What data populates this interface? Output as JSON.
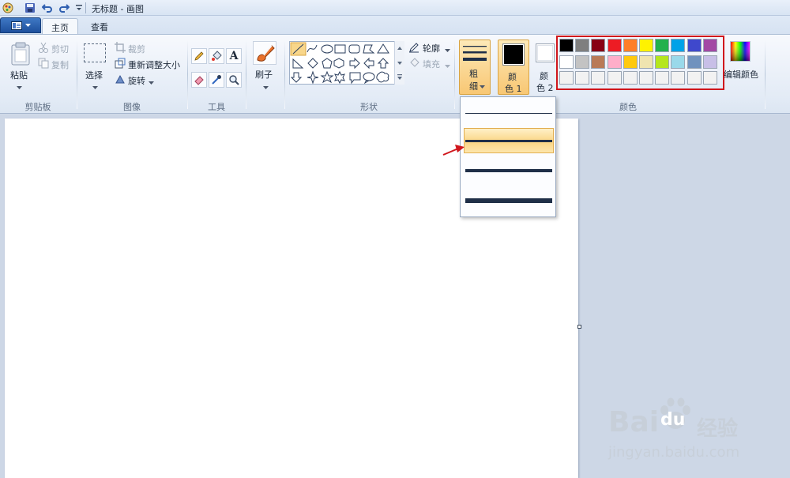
{
  "window": {
    "title": "无标题 - 画图"
  },
  "tabs": {
    "file_icon": "menu-icon",
    "home": "主页",
    "view": "查看"
  },
  "clipboard": {
    "paste": "粘贴",
    "cut": "剪切",
    "copy": "复制",
    "group": "剪贴板"
  },
  "image": {
    "select": "选择",
    "crop": "裁剪",
    "resize": "重新调整大小",
    "rotate": "旋转",
    "group": "图像"
  },
  "tools": {
    "group": "工具"
  },
  "brush": {
    "label": "刷子"
  },
  "shapes": {
    "outline": "轮廓",
    "fill": "填充",
    "group": "形状"
  },
  "size": {
    "line1": "粗",
    "line2": "细",
    "dropdown_selected_index": 2
  },
  "color1": {
    "line1": "颜",
    "line2": "色 1",
    "value": "#000000"
  },
  "color2": {
    "line1": "颜",
    "line2": "色 2",
    "value": "#ffffff"
  },
  "palette": {
    "group": "颜色",
    "edit_colors": "编辑颜色",
    "row1": [
      "#000000",
      "#7f7f7f",
      "#880015",
      "#ed1c24",
      "#ff7f27",
      "#fff200",
      "#22b14c",
      "#00a2e8",
      "#3f48cc",
      "#a349a4"
    ],
    "row2": [
      "#ffffff",
      "#c3c3c3",
      "#b97a57",
      "#ffaec9",
      "#ffc90e",
      "#efe4b0",
      "#b5e61d",
      "#99d9ea",
      "#7092be",
      "#c8bfe7"
    ],
    "row3": [
      "#f2f2f2",
      "#f2f2f2",
      "#f2f2f2",
      "#f2f2f2",
      "#f2f2f2",
      "#f2f2f2",
      "#f2f2f2",
      "#f2f2f2",
      "#f2f2f2",
      "#f2f2f2"
    ]
  },
  "watermark": {
    "brand": "Bai",
    "brand2": "du",
    "cn": "经验",
    "url": "jingyan.baidu.com"
  }
}
